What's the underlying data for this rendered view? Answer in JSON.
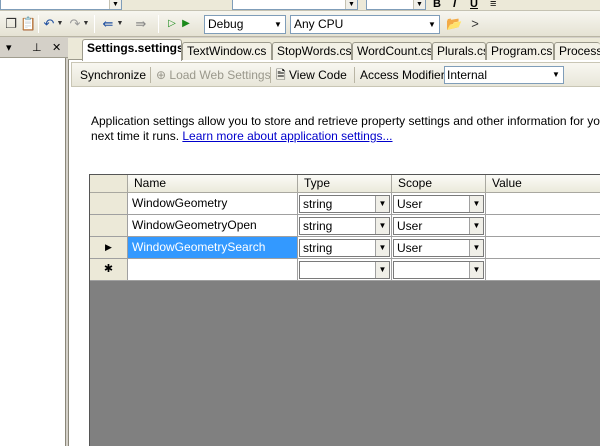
{
  "toolbar": {
    "config_combo": "Debug",
    "platform_combo": "Any CPU",
    "more_glyph": ">"
  },
  "tabs": [
    {
      "label": "Settings.settings*",
      "active": true
    },
    {
      "label": "TextWindow.cs"
    },
    {
      "label": "StopWords.cs"
    },
    {
      "label": "WordCount.cs"
    },
    {
      "label": "Plurals.cs"
    },
    {
      "label": "Program.cs"
    },
    {
      "label": "ProcessC"
    }
  ],
  "editor_toolbar": {
    "synchronize": "Synchronize",
    "load_web_settings": "Load Web Settings",
    "view_code": "View Code",
    "access_modifier_label": "Access Modifier:",
    "access_modifier_value": "Internal"
  },
  "description": {
    "line1": "Application settings allow you to store and retrieve property settings and other information for your",
    "line2": "next time it runs.",
    "link": "Learn more about application settings..."
  },
  "grid": {
    "columns": [
      "Name",
      "Type",
      "Scope",
      "Value"
    ],
    "rows": [
      {
        "name": "WindowGeometry",
        "type": "string",
        "scope": "User",
        "value": "",
        "marker": ""
      },
      {
        "name": "WindowGeometryOpen",
        "type": "string",
        "scope": "User",
        "value": "",
        "marker": ""
      },
      {
        "name": "WindowGeometrySearch",
        "type": "string",
        "scope": "User",
        "value": "",
        "marker": "▶",
        "selected": true
      },
      {
        "name": "",
        "type": "",
        "scope": "",
        "value": "",
        "marker": "✱"
      }
    ]
  },
  "colors": {
    "selection": "#3399ff",
    "link": "#0000cc"
  }
}
